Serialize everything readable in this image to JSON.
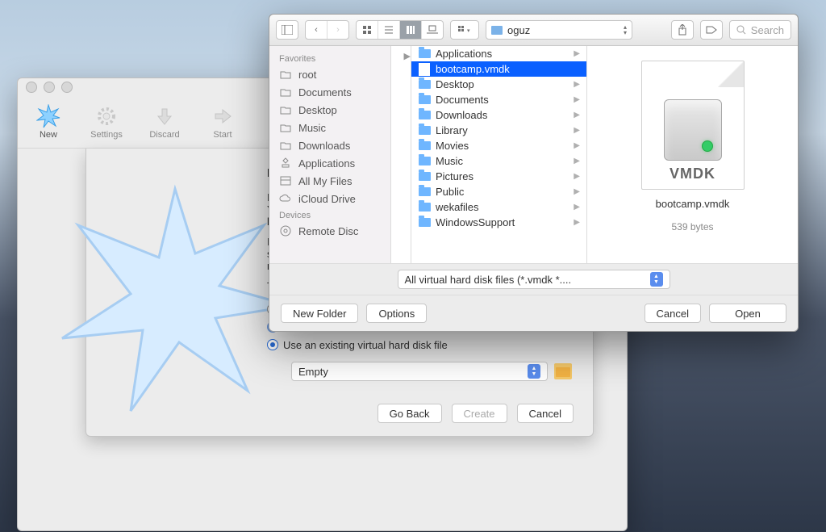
{
  "vbox": {
    "toolbar": {
      "new": "New",
      "settings": "Settings",
      "discard": "Discard",
      "start": "Start"
    },
    "wizard": {
      "title": "Hard",
      "text1": "If y",
      "text1b": "Yo",
      "text1c": "list",
      "text2": "If y",
      "text2b": "ste",
      "text2c": "ma",
      "text3": "Th",
      "radio3": "Use an existing virtual hard disk file",
      "disk_value": "Empty",
      "btn_goback": "Go Back",
      "btn_create": "Create",
      "btn_cancel": "Cancel"
    }
  },
  "finder": {
    "location": "oguz",
    "search_placeholder": "Search",
    "sidebar": {
      "favorites_header": "Favorites",
      "devices_header": "Devices",
      "favorites": [
        "root",
        "Documents",
        "Desktop",
        "Music",
        "Downloads",
        "Applications",
        "All My Files",
        "iCloud Drive"
      ],
      "devices": [
        "Remote Disc"
      ]
    },
    "col2": [
      {
        "name": "Applications",
        "type": "folder"
      },
      {
        "name": "bootcamp.vmdk",
        "type": "file",
        "selected": true
      },
      {
        "name": "Desktop",
        "type": "folder"
      },
      {
        "name": "Documents",
        "type": "folder"
      },
      {
        "name": "Downloads",
        "type": "folder"
      },
      {
        "name": "Library",
        "type": "folder"
      },
      {
        "name": "Movies",
        "type": "folder"
      },
      {
        "name": "Music",
        "type": "folder"
      },
      {
        "name": "Pictures",
        "type": "folder"
      },
      {
        "name": "Public",
        "type": "folder"
      },
      {
        "name": "wekafiles",
        "type": "folder"
      },
      {
        "name": "WindowsSupport",
        "type": "folder"
      }
    ],
    "preview": {
      "type_label": "VMDK",
      "filename": "bootcamp.vmdk",
      "size": "539 bytes"
    },
    "filter_label": "All virtual hard disk files (*.vmdk *....",
    "buttons": {
      "new_folder": "New Folder",
      "options": "Options",
      "cancel": "Cancel",
      "open": "Open"
    }
  }
}
